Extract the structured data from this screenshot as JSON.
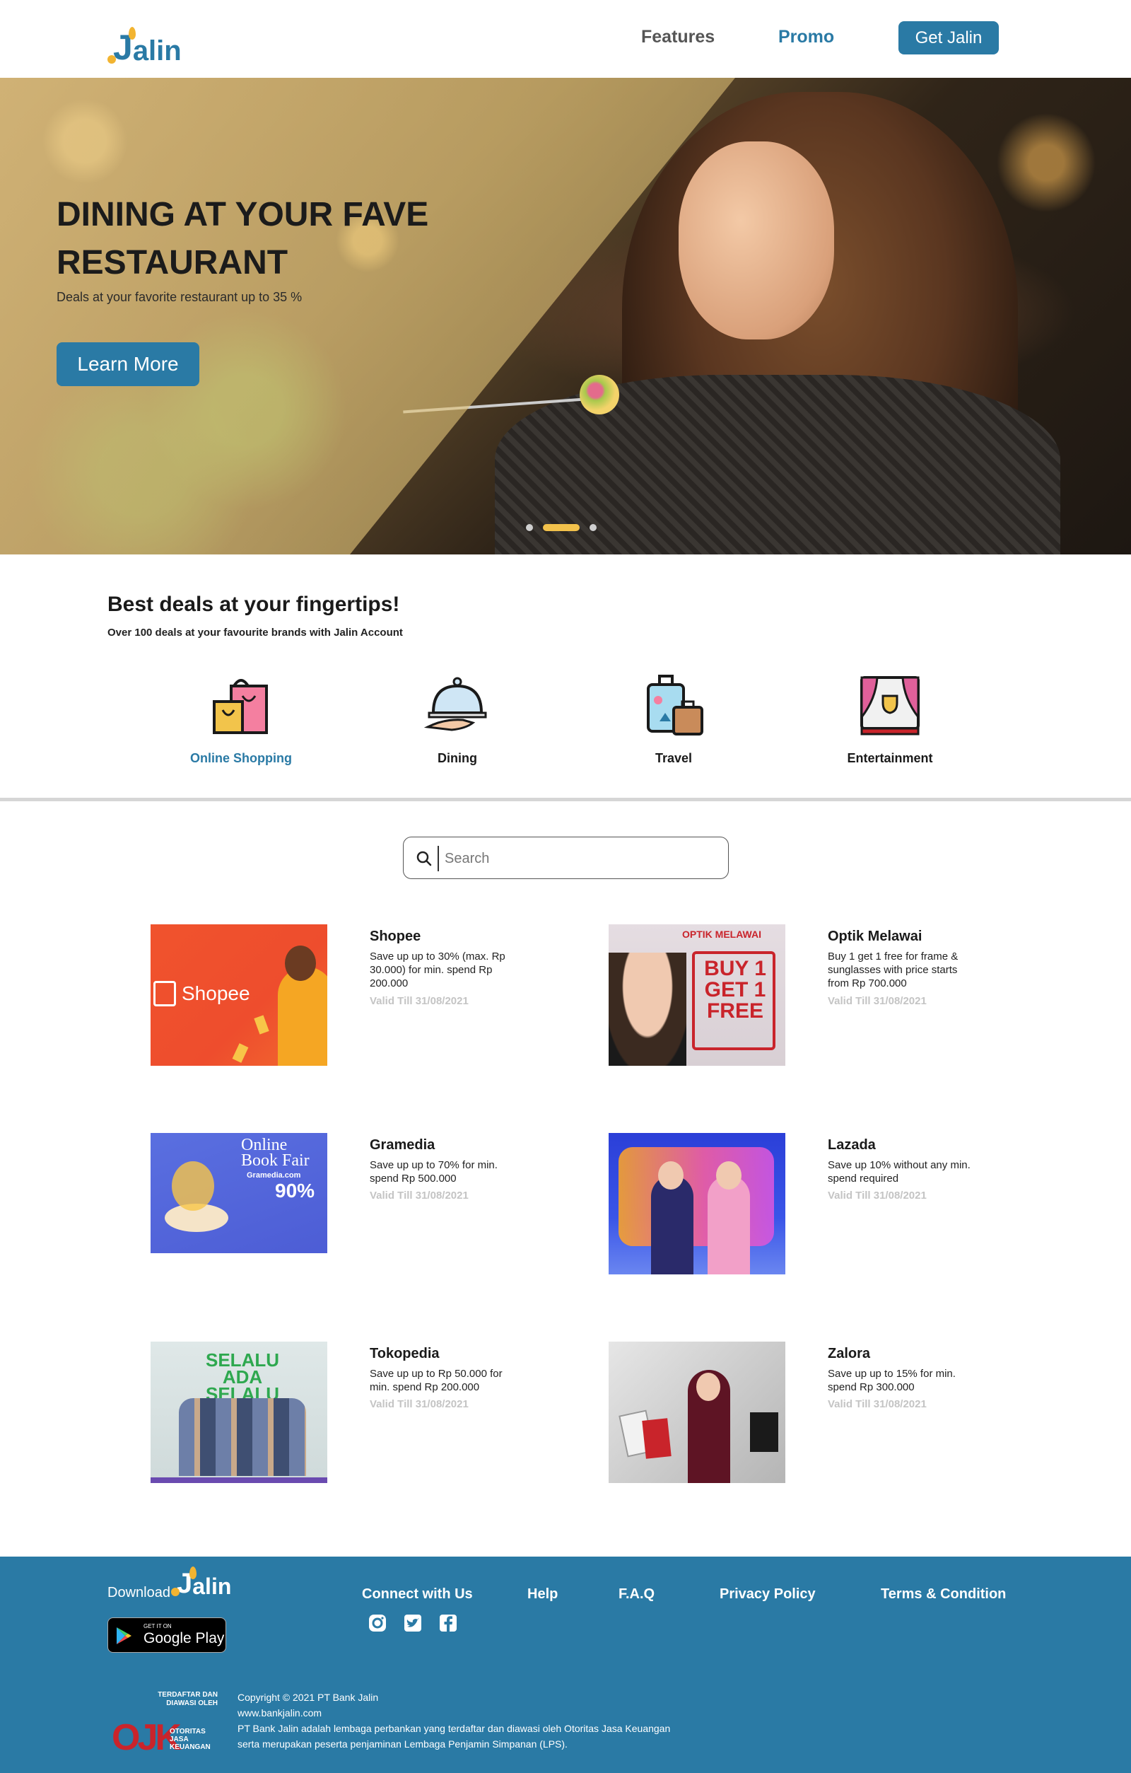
{
  "brand": {
    "logo_j": "J",
    "logo_rest": "alin",
    "primary_color": "#2a7aa5",
    "accent_color": "#f2b431"
  },
  "nav": {
    "features": "Features",
    "promo": "Promo",
    "cta": "Get Jalin"
  },
  "hero": {
    "title": "DINING AT YOUR FAVE RESTAURANT",
    "subtitle": "Deals at your favorite restaurant up to 35 %",
    "button": "Learn More",
    "carousel": {
      "slides": 3,
      "active_index": 1
    }
  },
  "deals": {
    "title": "Best deals at your fingertips!",
    "subtitle": "Over 100 deals at your favourite brands with Jalin Account",
    "categories": [
      {
        "label": "Online Shopping",
        "icon": "shopping-bag-icon",
        "active": true
      },
      {
        "label": "Dining",
        "icon": "serving-cloche-icon",
        "active": false
      },
      {
        "label": "Travel",
        "icon": "luggage-icon",
        "active": false
      },
      {
        "label": "Entertainment",
        "icon": "theater-stage-icon",
        "active": false
      }
    ]
  },
  "search": {
    "placeholder": "Search"
  },
  "promos": [
    {
      "brand": "Shopee",
      "desc": "Save up up to 30% (max. Rp 30.000) for min. spend Rp 200.000",
      "valid": "Valid Till 31/08/2021",
      "image_text": "Shopee"
    },
    {
      "brand": "Optik Melawai",
      "desc": "Buy 1 get 1 free for frame & sunglasses with price starts from Rp 700.000",
      "valid": "Valid Till 31/08/2021",
      "image_text": "OPTIK MELAWAI",
      "image_text2": "BUY 1 GET 1 FREE"
    },
    {
      "brand": "Gramedia",
      "desc": "Save up up to 70% for min. spend Rp 500.000",
      "valid": "Valid Till 31/08/2021",
      "image_text": "Online Book Fair",
      "image_text2": "Gramedia.com",
      "image_text3": "90%"
    },
    {
      "brand": "Lazada",
      "desc": "Save up 10% without any min. spend required",
      "valid": "Valid Till 31/08/2021"
    },
    {
      "brand": "Tokopedia",
      "desc": "Save up up to Rp 50.000 for min. spend Rp 200.000",
      "valid": "Valid Till 31/08/2021",
      "image_text": "SELALU ADA SELALU BISA"
    },
    {
      "brand": "Zalora",
      "desc": "Save up up to 15% for min. spend Rp 300.000",
      "valid": "Valid Till 31/08/2021"
    }
  ],
  "footer": {
    "download": "Download",
    "google_play_small": "GET IT ON",
    "google_play_big": "Google Play",
    "links": [
      "Connect with Us",
      "Help",
      "F.A.Q",
      "Privacy Policy",
      "Terms & Condition"
    ],
    "social_icons": [
      "instagram-icon",
      "twitter-icon",
      "facebook-icon"
    ],
    "ojk_top": "TERDAFTAR DAN DIAWASI OLEH",
    "ojk_mark": "OJK",
    "ojk_sub": "OTORITAS JASA KEUANGAN",
    "copyright": "Copyright © 2021 PT Bank Jalin",
    "website": "www.bankjalin.com",
    "legal_1": "PT Bank Jalin adalah lembaga perbankan yang terdaftar dan diawasi oleh Otoritas Jasa Keuangan",
    "legal_2": "serta merupakan peserta penjaminan Lembaga Penjamin Simpanan (LPS)."
  }
}
